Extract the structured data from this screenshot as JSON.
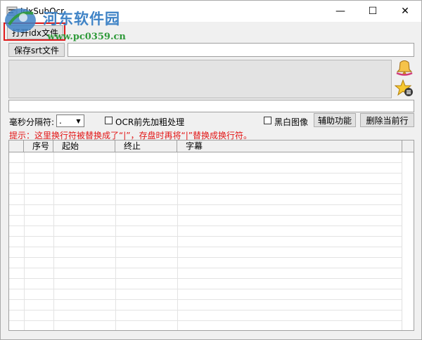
{
  "window": {
    "title": "IdxSubOcr",
    "controls": {
      "minimize": "—",
      "maximize": "☐",
      "close": "✕"
    }
  },
  "watermark": {
    "site_name": "河东软件园",
    "url": "www.pc0359.cn"
  },
  "toolbar": {
    "open_idx_label": "打开idx文件",
    "save_srt_label": "保存srt文件",
    "save_path_value": ""
  },
  "options": {
    "ms_separator_label": "毫秒分隔符:",
    "ms_separator_value": ".",
    "ocr_bold_label": "OCR前先加粗处理",
    "bw_image_label": "黑白图像",
    "aux_button_label": "辅助功能",
    "delete_row_label": "删除当前行"
  },
  "hint": "提示：这里换行符被替换成了“|”，存盘时再将“|”替换成换行符。",
  "table": {
    "columns": [
      "",
      "序号",
      "起始",
      "终止",
      "字幕"
    ],
    "rows": []
  },
  "colors": {
    "hint": "#e21515",
    "highlight": "#e01a1a",
    "watermark_blue": "#3f83c6",
    "watermark_green": "#2f9a3a"
  }
}
